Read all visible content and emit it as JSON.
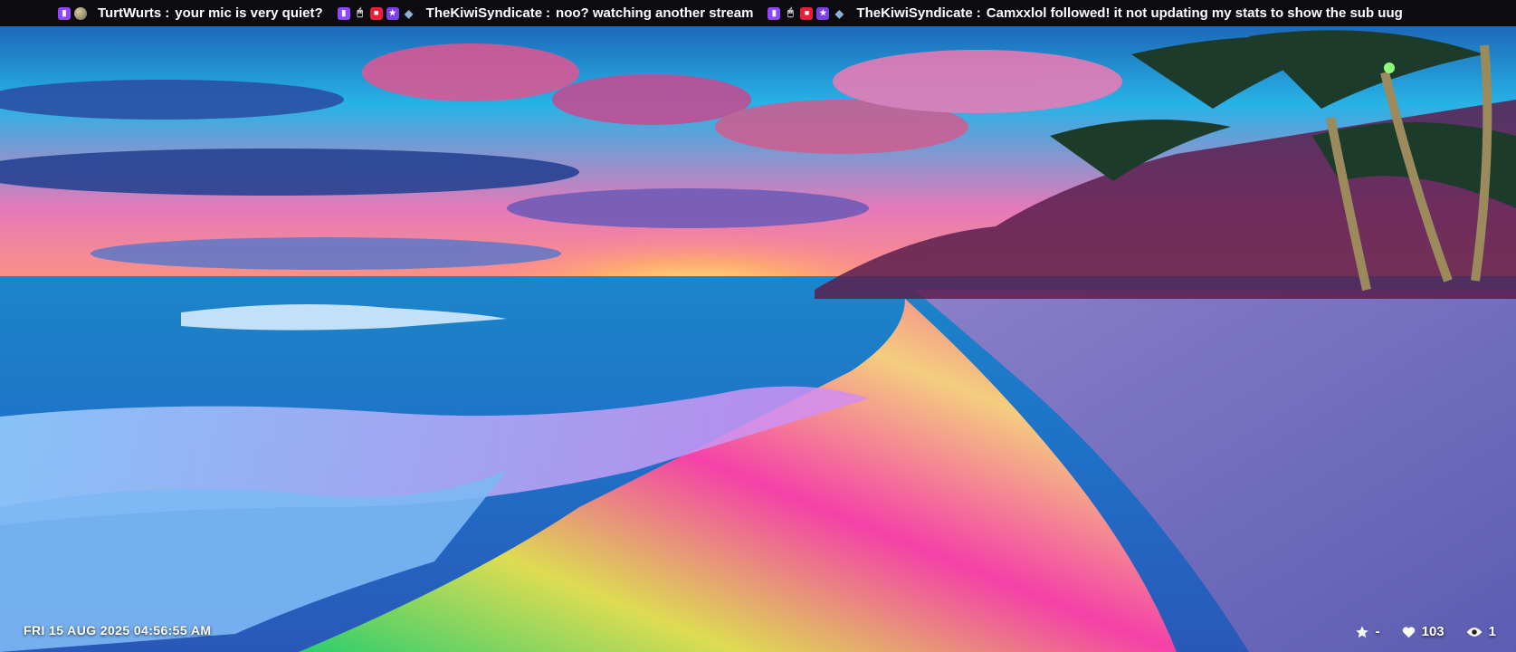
{
  "ticker": {
    "messages": [
      {
        "badges": [
          "twitch-icon",
          "globe-icon"
        ],
        "user": "TurtWurts",
        "separator": ":",
        "text": "your mic is very quiet?"
      },
      {
        "badges": [
          "twitch-icon",
          "mouse-icon",
          "camera-icon",
          "star-icon",
          "gem-icon"
        ],
        "user": "TheKiwiSyndicate",
        "separator": ":",
        "text": "noo?  watching another stream"
      },
      {
        "badges": [
          "twitch-icon",
          "mouse-icon",
          "camera-icon",
          "star-icon",
          "gem-icon"
        ],
        "user": "TheKiwiSyndicate",
        "separator": ":",
        "text": "Camxxlol followed!  it not updating my stats to show the sub uug"
      }
    ]
  },
  "clock": {
    "text": "FRI 15 AUG 2025 04:56:55 AM"
  },
  "stats": {
    "star_value": "-",
    "likes_value": "103",
    "viewers_value": "1"
  },
  "colors": {
    "ticker_bg": "#0c0c10",
    "twitch": "#9146ff",
    "camera_badge": "#e91e3a",
    "star_badge": "#7b3fe4",
    "overlay_text": "#ffffff"
  }
}
